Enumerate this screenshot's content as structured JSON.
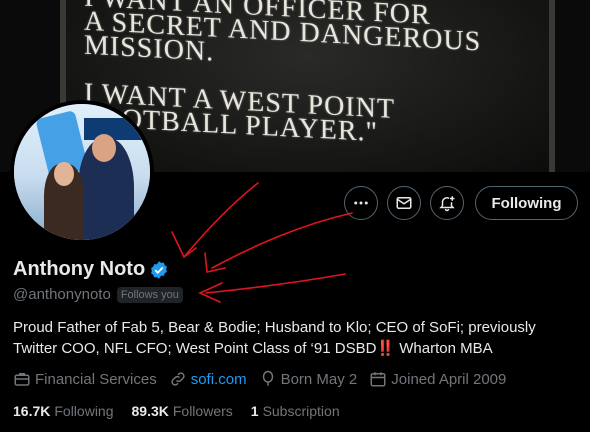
{
  "banner": {
    "plaque_text": "I WANT AN OFFICER FOR\nA SECRET AND DANGEROUS\nMISSION.\n\nI WANT A WEST POINT\nFOOTBALL PLAYER.\""
  },
  "profile": {
    "name": "Anthony Noto",
    "handle": "@anthonynoto",
    "follows_you": "Follows you",
    "bio_main": "Proud Father of Fab 5, Bear & Bodie; Husband to Klo; CEO of SoFi; previously Twitter COO, NFL CFO; West Point Class of ‘91 DSBD",
    "bio_emoji": "‼️",
    "bio_end": " Wharton MBA"
  },
  "actions": {
    "following_label": "Following",
    "more_icon": "more-icon",
    "message_icon": "mail-icon",
    "notify_icon": "bell-plus-icon"
  },
  "meta": {
    "category": "Financial Services",
    "website": "sofi.com",
    "born": "Born May 2",
    "joined": "Joined April 2009"
  },
  "counts": {
    "following_value": "16.7K",
    "following_label": "Following",
    "followers_value": "89.3K",
    "followers_label": "Followers",
    "subscription_value": "1",
    "subscription_label": "Subscription"
  },
  "colors": {
    "accent": "#1d9bf0",
    "secondary_text": "#71767b",
    "arrow": "#e0141e"
  }
}
